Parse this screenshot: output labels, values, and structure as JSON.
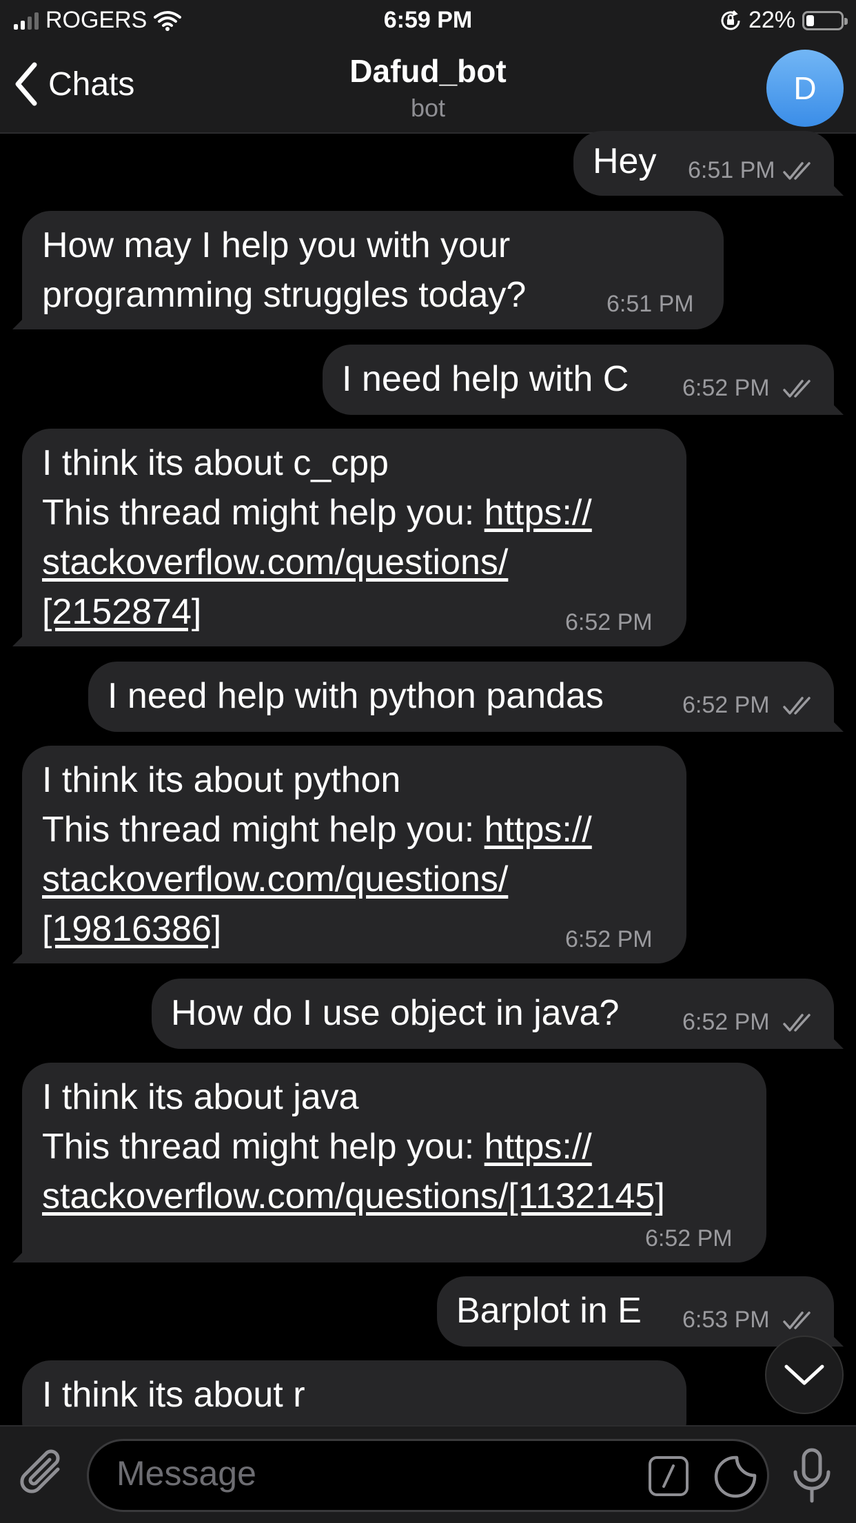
{
  "status_bar": {
    "carrier": "ROGERS",
    "time": "6:59 PM",
    "battery_percent": "22%",
    "battery_level": 0.22
  },
  "header": {
    "back_label": "Chats",
    "title": "Dafud_bot",
    "subtitle": "bot",
    "avatar_initial": "D"
  },
  "messages": [
    {
      "direction": "out",
      "lines": [
        "Hey"
      ],
      "time": "6:51 PM",
      "read": true
    },
    {
      "direction": "in",
      "lines": [
        "How may I help you with your",
        "programming struggles today?"
      ],
      "time": "6:51 PM"
    },
    {
      "direction": "out",
      "lines": [
        "I need help with C"
      ],
      "time": "6:52 PM",
      "read": true
    },
    {
      "direction": "in",
      "lines": [
        "I think its about c_cpp",
        "This thread might help you: ",
        "stackoverflow.com/questions/",
        "[2152874]"
      ],
      "link_fragment": "https://",
      "time": "6:52 PM"
    },
    {
      "direction": "out",
      "lines": [
        "I need help with python pandas"
      ],
      "time": "6:52 PM",
      "read": true
    },
    {
      "direction": "in",
      "lines": [
        "I think its about python",
        "This thread might help you: ",
        "stackoverflow.com/questions/",
        "[19816386]"
      ],
      "link_fragment": "https://",
      "time": "6:52 PM"
    },
    {
      "direction": "out",
      "lines": [
        "How do I use object in java?"
      ],
      "time": "6:52 PM",
      "read": true
    },
    {
      "direction": "in",
      "lines": [
        "I think its about java",
        "This thread might help you: ",
        "stackoverflow.com/questions/[1132145]"
      ],
      "link_fragment": "https://",
      "time": "6:52 PM"
    },
    {
      "direction": "out",
      "lines": [
        "Barplot in E"
      ],
      "time": "6:53 PM",
      "read": true
    },
    {
      "direction": "in",
      "lines": [
        "I think its about r"
      ]
    }
  ],
  "input": {
    "placeholder": "Message"
  },
  "colors": {
    "background": "#000000",
    "bubble": "#262628",
    "bar": "#1c1c1d",
    "avatar_gradient_top": "#72b6f5",
    "avatar_gradient_bottom": "#3a8de8"
  }
}
